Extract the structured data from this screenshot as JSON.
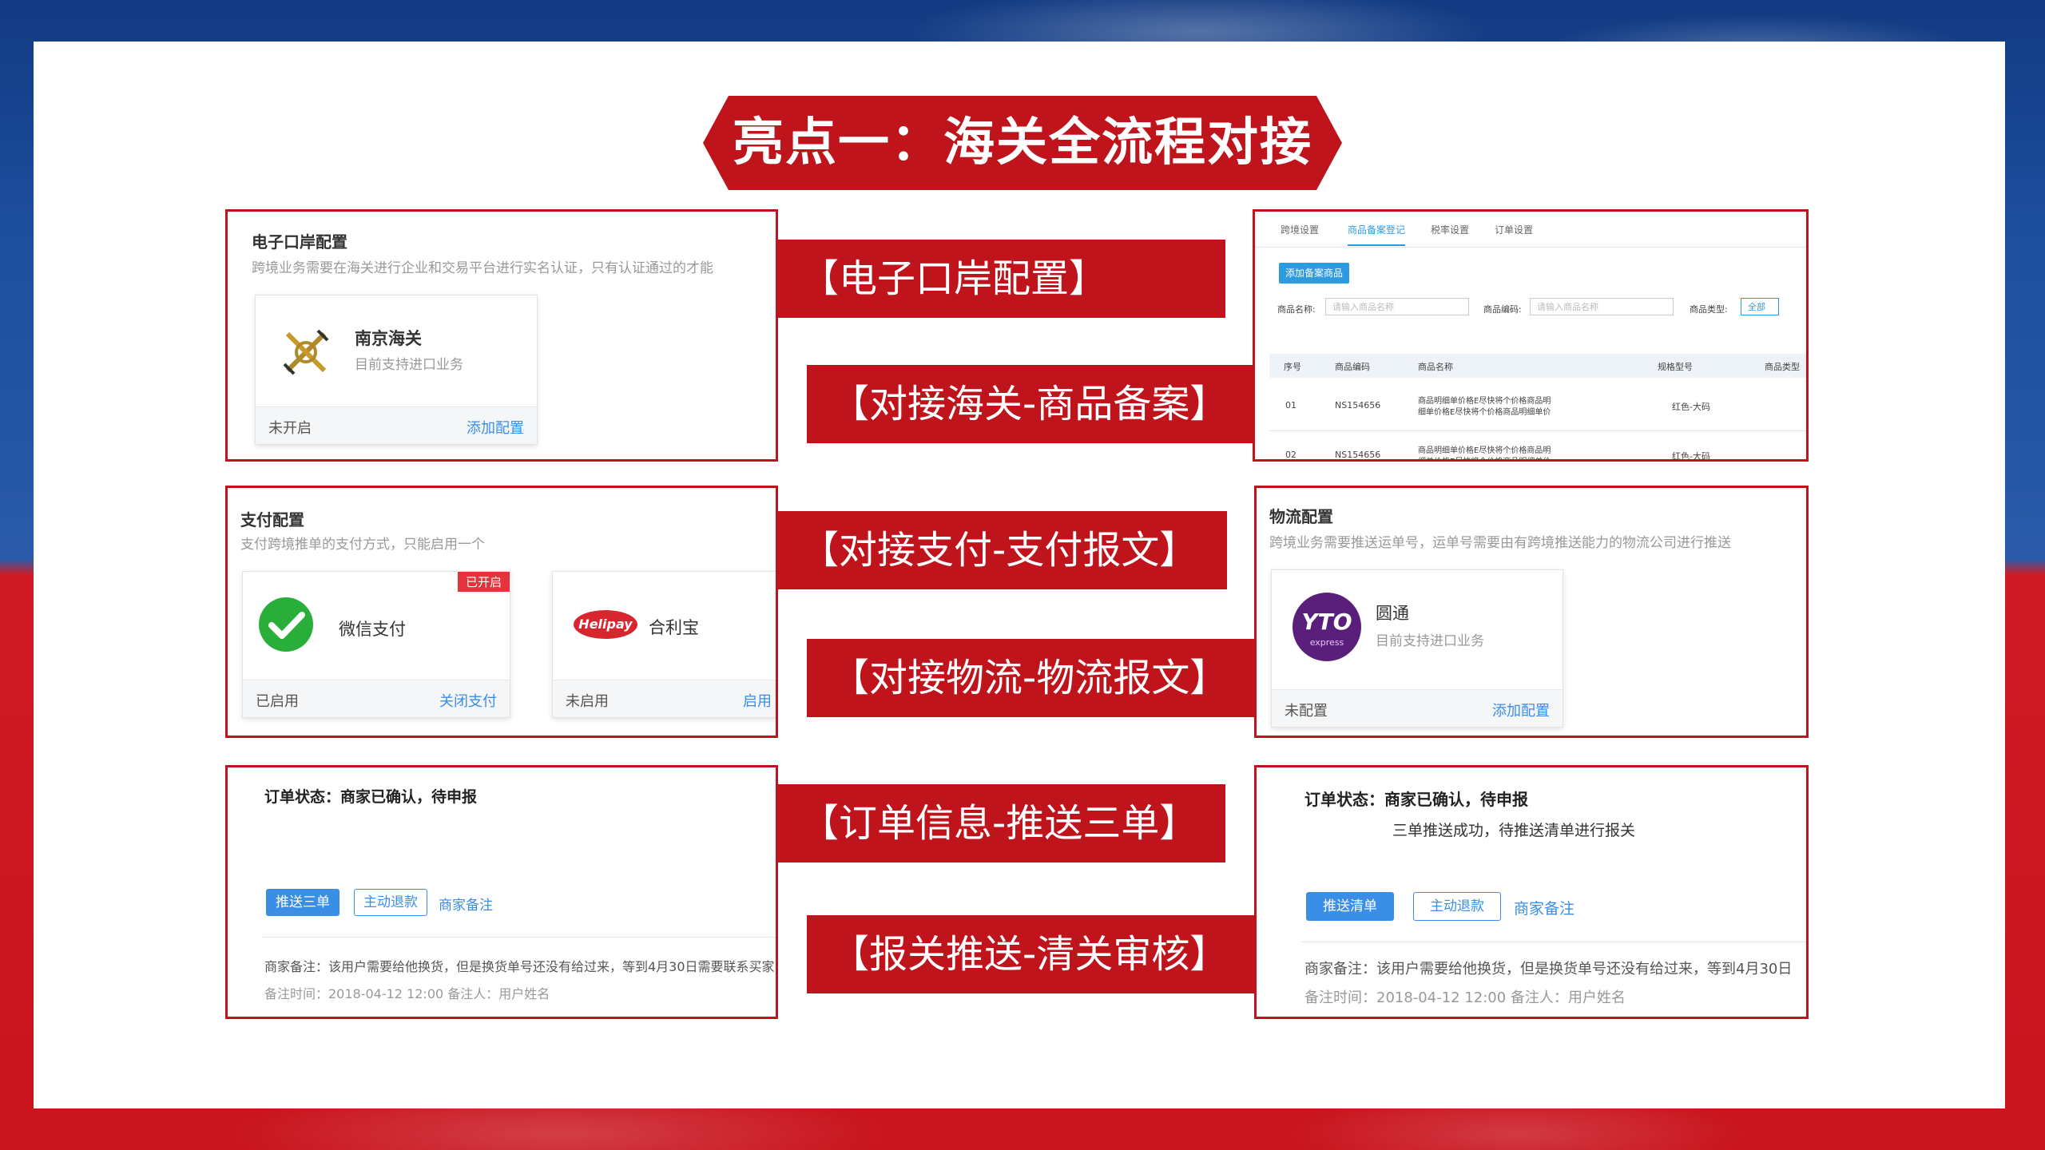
{
  "title": "亮点一：海关全流程对接",
  "labels": {
    "eport": "【电子口岸配置】",
    "goods": "【对接海关-商品备案】",
    "pay": "【对接支付-支付报文】",
    "logistics": "【对接物流-物流报文】",
    "order": "【订单信息-推送三单】",
    "customs": "【报关推送-清关审核】"
  },
  "eport_panel": {
    "title": "电子口岸配置",
    "desc": "跨境业务需要在海关进行企业和交易平台进行实名认证，只有认证通过的才能",
    "card": {
      "name": "南京海关",
      "desc": "目前支持进口业务",
      "status": "未开启",
      "action": "添加配置",
      "icon": "customs-emblem-icon"
    }
  },
  "goods_panel": {
    "tabs": [
      "跨境设置",
      "商品备案登记",
      "税率设置",
      "订单设置"
    ],
    "add_button": "添加备案商品",
    "filters": {
      "name_label": "商品名称:",
      "name_placeholder": "请输入商品名称",
      "code_label": "商品编码:",
      "code_placeholder": "请输入商品名称",
      "type_label": "商品类型:",
      "type_value": "全部"
    },
    "columns": [
      "序号",
      "商品编码",
      "商品名称",
      "规格型号",
      "商品类型"
    ],
    "rows": [
      {
        "no": "01",
        "code": "NS154656",
        "name1": "商品明细单价格E尽快将个价格商品明",
        "name2": "细单价格E尽快将个价格商品明细单价",
        "spec": "红色-大码"
      },
      {
        "no": "02",
        "code": "NS154656",
        "name1": "商品明细单价格E尽快将个价格商品明",
        "name2": "细单价格E尽快将个价格商品明细单价",
        "spec": "红色-大码"
      }
    ]
  },
  "pay_panel": {
    "title": "支付配置",
    "desc": "支付跨境推单的支付方式，只能启用一个",
    "cards": [
      {
        "name": "微信支付",
        "badge": "已开启",
        "status": "已启用",
        "action": "关闭支付",
        "icon": "wechat-pay-icon"
      },
      {
        "name": "合利宝",
        "logo_text": "Helipay",
        "status": "未启用",
        "action": "启用",
        "icon": "helipay-logo-icon"
      }
    ]
  },
  "logistics_panel": {
    "title": "物流配置",
    "desc": "跨境业务需要推送运单号，运单号需要由有跨境推送能力的物流公司进行推送",
    "card": {
      "name": "圆通",
      "desc": "目前支持进口业务",
      "status": "未配置",
      "action": "添加配置",
      "logo_text": "YTO",
      "logo_sub": "express",
      "icon": "yto-express-logo-icon"
    }
  },
  "order_left": {
    "status": "订单状态：商家已确认，待申报",
    "buttons": [
      "推送三单",
      "主动退款"
    ],
    "link": "商家备注",
    "note": "商家备注：该用户需要给他换货，但是换货单号还没有给过来，等到4月30日需要联系买家",
    "time": "备注时间：2018-04-12  12:00    备注人：用户姓名"
  },
  "order_right": {
    "status": "订单状态：商家已确认，待申报",
    "sub_status": "三单推送成功，待推送清单进行报关",
    "buttons": [
      "推送清单",
      "主动退款"
    ],
    "link": "商家备注",
    "note": "商家备注：该用户需要给他换货，但是换货单号还没有给过来，等到4月30日",
    "time": "备注时间：2018-04-12  12:00    备注人：用户姓名"
  },
  "colors": {
    "accent_red": "#c0141c",
    "link_blue": "#3a8ee6",
    "wechat_green": "#2aae3a"
  }
}
